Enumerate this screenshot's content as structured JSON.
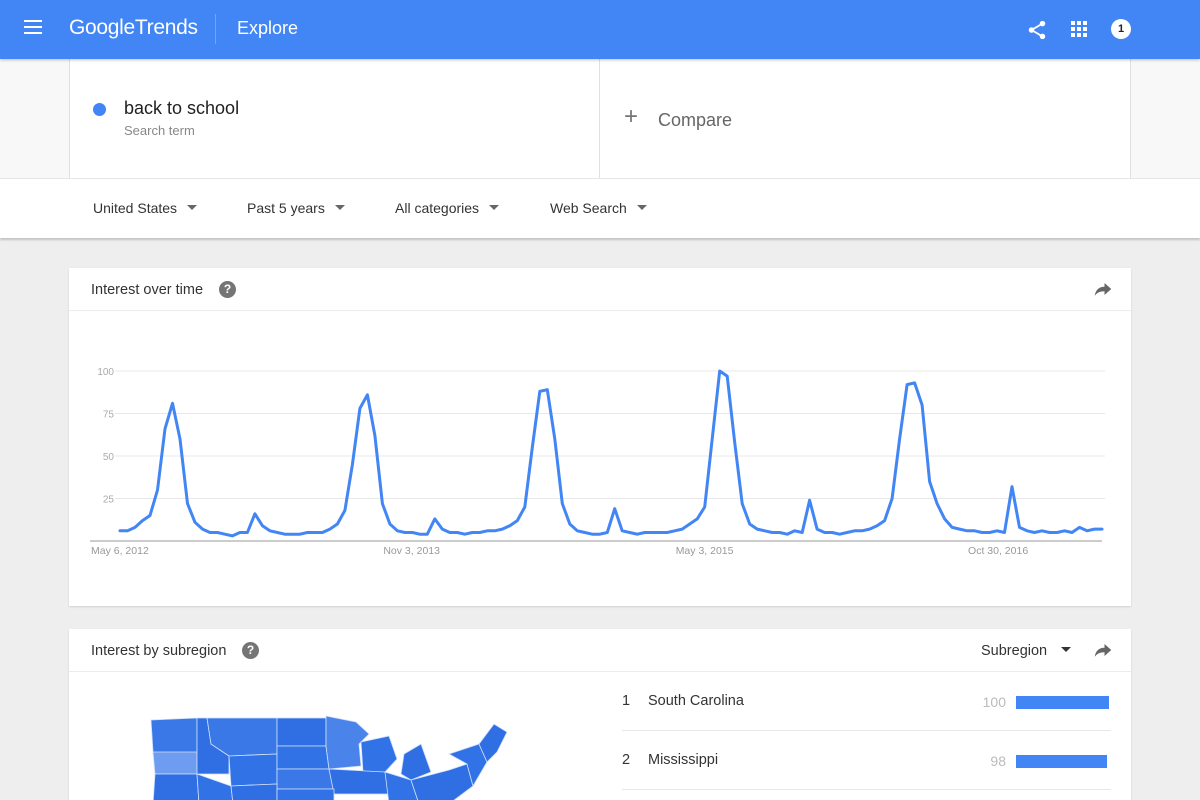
{
  "app": {
    "brand": "Google Trends",
    "brand_google": "Google",
    "brand_trends": "Trends",
    "section": "Explore",
    "account_badge": "1",
    "accent_color": "#4285f4"
  },
  "search": {
    "term": "back to school",
    "term_type": "Search term",
    "term_color": "#4285f4",
    "compare_icon": "+",
    "compare_label": "Compare"
  },
  "filters": [
    {
      "label": "United States"
    },
    {
      "label": "Past 5 years"
    },
    {
      "label": "All categories"
    },
    {
      "label": "Web Search"
    }
  ],
  "interest_over_time": {
    "title": "Interest over time",
    "help_icon": "?"
  },
  "interest_by_subregion": {
    "title": "Interest by subregion",
    "help_icon": "?",
    "resolution_select": "Subregion",
    "rows": [
      {
        "rank": "1",
        "name": "South Carolina",
        "value": "100",
        "fraction": 1.0
      },
      {
        "rank": "2",
        "name": "Mississippi",
        "value": "98",
        "fraction": 0.98
      }
    ]
  },
  "chart_data": {
    "type": "line",
    "title": "Interest over time",
    "xlabel": "",
    "ylabel": "",
    "ylim": [
      0,
      100
    ],
    "yticks": [
      25,
      50,
      75,
      100
    ],
    "ytick_labels": [
      "25",
      "50",
      "75",
      "100"
    ],
    "xtick_labels": [
      "May 6, 2012",
      "Nov 3, 2013",
      "May 3, 2015",
      "Oct 30, 2016"
    ],
    "xtick_index": [
      0,
      78,
      156,
      234
    ],
    "grid": true,
    "legend": "none",
    "series": [
      {
        "name": "back to school",
        "color": "#4285f4",
        "interval": "2 weeks",
        "start": "May 6, 2012",
        "values": [
          6,
          6,
          8,
          12,
          15,
          30,
          66,
          81,
          60,
          22,
          11,
          7,
          5,
          5,
          4,
          3,
          5,
          5,
          16,
          9,
          6,
          5,
          4,
          4,
          4,
          5,
          5,
          5,
          7,
          10,
          18,
          45,
          78,
          86,
          62,
          22,
          10,
          6,
          5,
          5,
          4,
          4,
          13,
          7,
          5,
          5,
          4,
          5,
          5,
          6,
          6,
          7,
          9,
          12,
          20,
          55,
          88,
          89,
          60,
          22,
          10,
          6,
          5,
          4,
          4,
          5,
          19,
          6,
          5,
          4,
          5,
          5,
          5,
          5,
          6,
          7,
          10,
          13,
          20,
          60,
          100,
          97,
          58,
          22,
          10,
          7,
          6,
          5,
          5,
          4,
          6,
          5,
          24,
          7,
          5,
          5,
          4,
          5,
          6,
          6,
          7,
          9,
          12,
          25,
          60,
          92,
          93,
          80,
          35,
          22,
          13,
          8,
          7,
          6,
          6,
          5,
          5,
          6,
          5,
          32,
          8,
          6,
          5,
          6,
          5,
          5,
          6,
          5,
          8,
          6,
          7,
          7
        ]
      }
    ]
  }
}
